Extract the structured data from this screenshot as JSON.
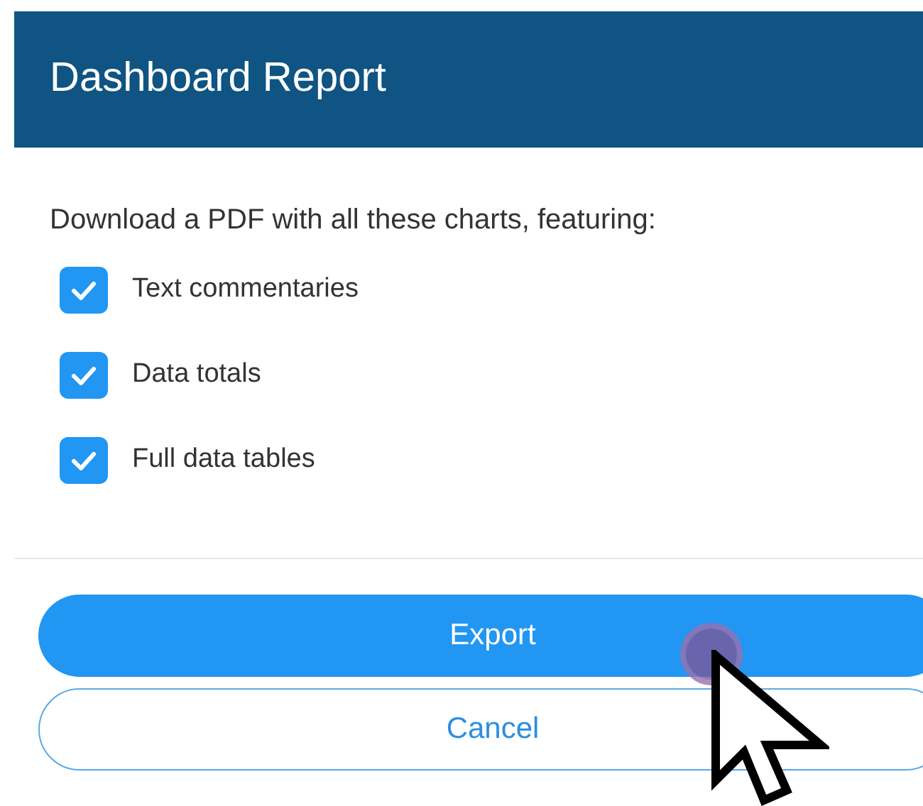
{
  "dialog": {
    "title": "Dashboard Report",
    "intro": "Download a PDF with all these charts, featuring:",
    "options": [
      {
        "label": "Text commentaries",
        "checked": true
      },
      {
        "label": "Data totals",
        "checked": true
      },
      {
        "label": "Full data tables",
        "checked": true
      }
    ],
    "buttons": [
      {
        "label": "Export",
        "kind": "primary"
      },
      {
        "label": "Cancel",
        "kind": "secondary"
      }
    ]
  }
}
